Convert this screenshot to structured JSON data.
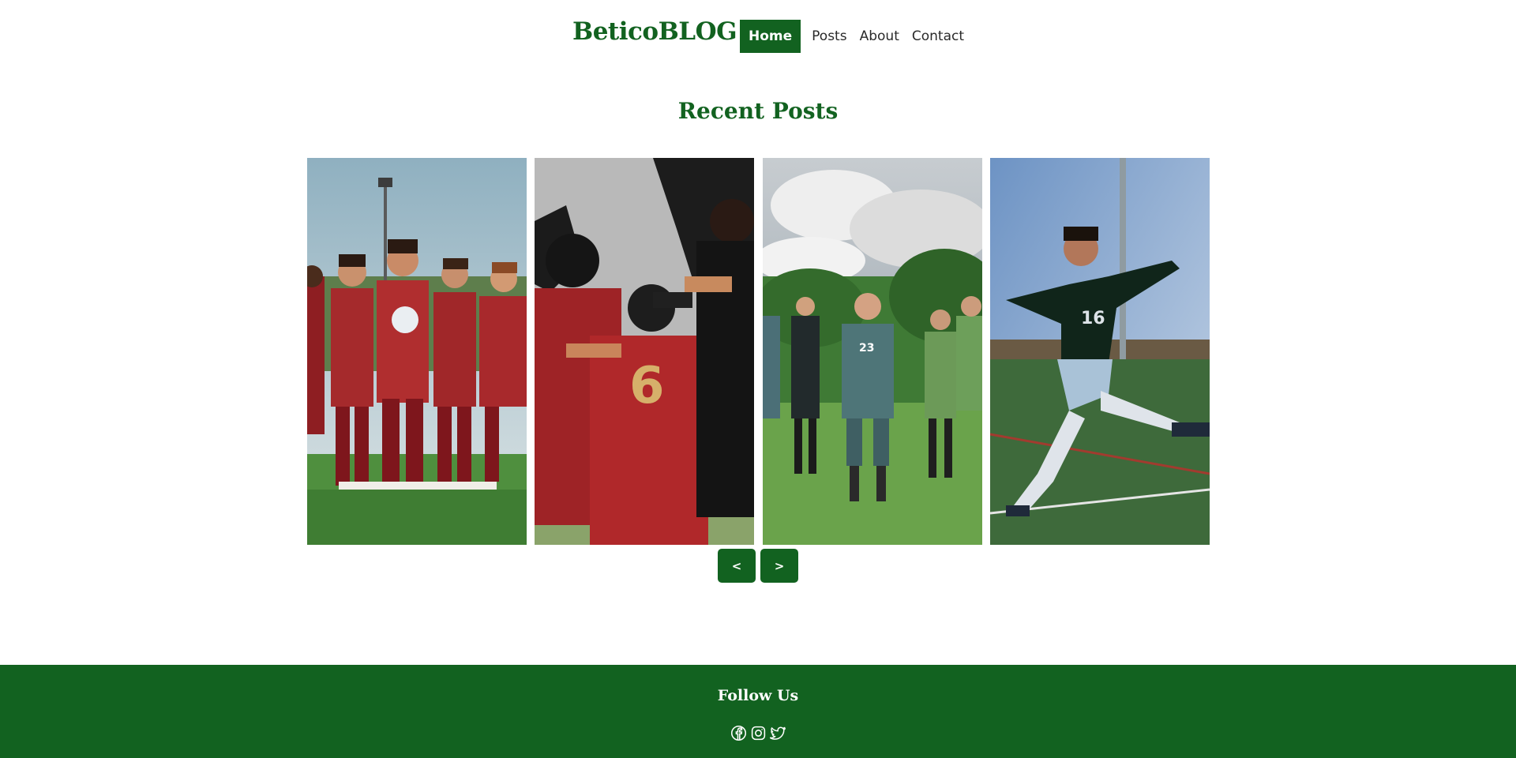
{
  "header": {
    "brand": "BeticoBLOG",
    "nav": [
      {
        "label": "Home",
        "active": true
      },
      {
        "label": "Posts",
        "active": false
      },
      {
        "label": "About",
        "active": false
      },
      {
        "label": "Contact",
        "active": false
      }
    ]
  },
  "main": {
    "section_title": "Recent Posts",
    "posts": [
      {
        "image": "team-photo-maroon-kits"
      },
      {
        "image": "players-huddle-number-6"
      },
      {
        "image": "players-walking-green-kits"
      },
      {
        "image": "player-kicking-number-16"
      }
    ],
    "controls": {
      "prev_label": "<",
      "next_label": ">"
    }
  },
  "footer": {
    "title": "Follow Us",
    "social": [
      "facebook-icon",
      "instagram-icon",
      "twitter-icon"
    ]
  },
  "colors": {
    "brand_green": "#126220",
    "white": "#ffffff"
  }
}
